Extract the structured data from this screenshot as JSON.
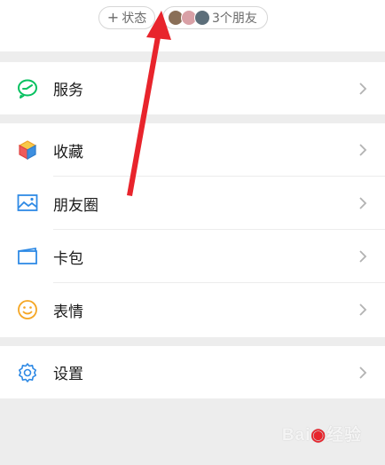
{
  "header": {
    "status_pill": {
      "icon": "plus-icon",
      "label": "状态"
    },
    "friends_pill": {
      "label": "3个朋友",
      "avatar_count": 3
    }
  },
  "menu": {
    "services": {
      "label": "服务",
      "icon": "wallet-chat-icon",
      "color": "#07c160"
    },
    "favorites": {
      "label": "收藏",
      "icon": "cube-icon",
      "color": "#f5a623"
    },
    "moments": {
      "label": "朋友圈",
      "icon": "picture-icon",
      "color": "#2f8ae5"
    },
    "cards": {
      "label": "卡包",
      "icon": "card-icon",
      "color": "#2f8ae5"
    },
    "stickers": {
      "label": "表情",
      "icon": "smile-icon",
      "color": "#f5a623"
    },
    "settings": {
      "label": "设置",
      "icon": "gear-icon",
      "color": "#2f8ae5"
    }
  },
  "annotation": {
    "color": "#e8242c"
  },
  "watermark": {
    "text": "Bai 经验"
  }
}
